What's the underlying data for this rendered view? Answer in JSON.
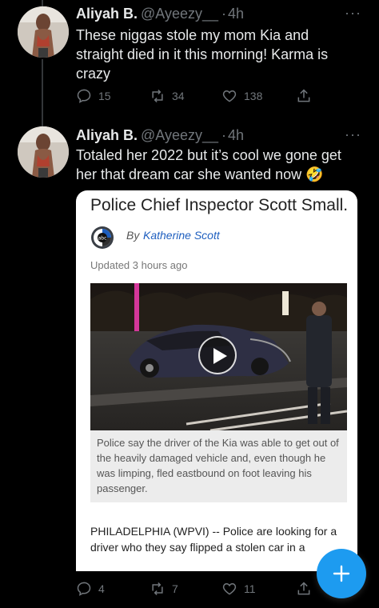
{
  "tweets": [
    {
      "name": "Aliyah B.",
      "handle": "@Ayeezy__",
      "separator": "·",
      "time": "4h",
      "more": "···",
      "text": "These niggas stole my mom Kia and straight died in it this morning! Karma is crazy",
      "replies": "15",
      "retweets": "34",
      "likes": "138"
    },
    {
      "name": "Aliyah B.",
      "handle": "@Ayeezy__",
      "separator": "·",
      "time": "4h",
      "more": "···",
      "text": "Totaled her 2022 but it’s cool we gone get her that dream car she wanted now 🤣",
      "replies": "4",
      "retweets": "7",
      "likes": "11"
    }
  ],
  "article": {
    "title": "Police Chief Inspector Scott Small.",
    "by_label": "By",
    "author": "Katherine Scott",
    "updated": "Updated 3 hours ago",
    "caption": "Police say the driver of the Kia was able to get out of the heavily damaged vehicle and, even though he was limping, fled eastbound on foot leaving his passenger.",
    "body": "PHILADELPHIA (WPVI) -- Police are looking for a driver who they say flipped a stolen car in a"
  },
  "icons": {
    "reply": "reply-icon",
    "retweet": "retweet-icon",
    "like": "heart-icon",
    "share": "share-icon",
    "compose": "plus-icon",
    "play": "play-icon"
  },
  "colors": {
    "background": "#000000",
    "text": "#e7e9ea",
    "muted": "#71767b",
    "accent": "#1d9bf0",
    "author_link": "#1f5fbf"
  }
}
